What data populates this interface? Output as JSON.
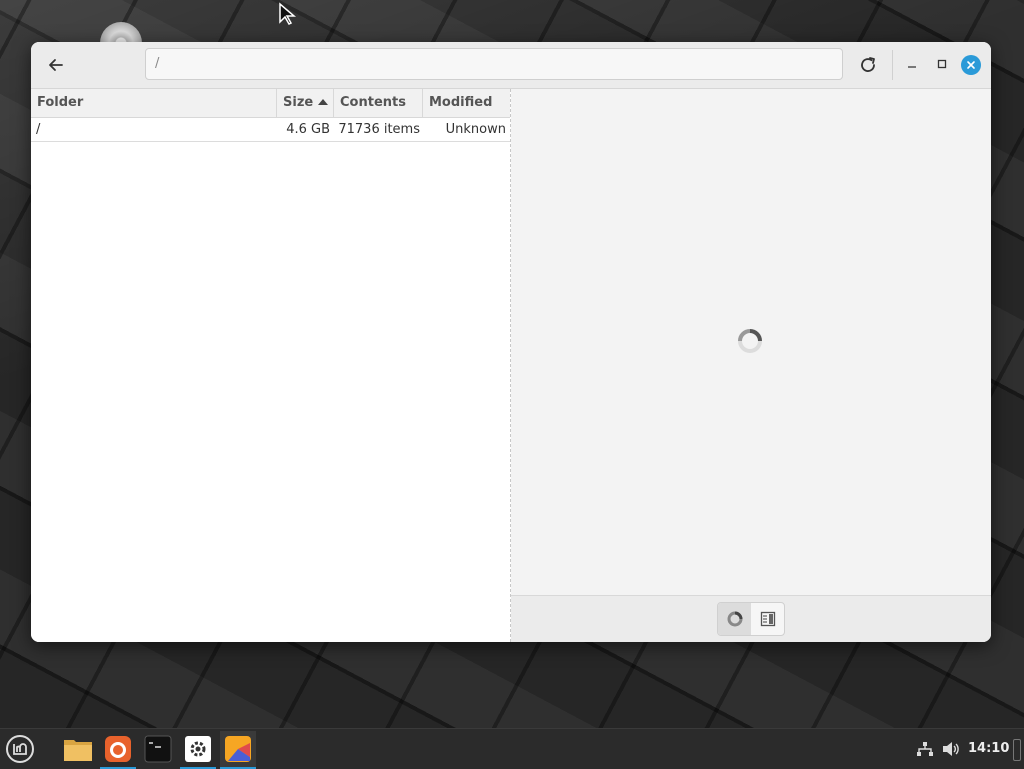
{
  "window": {
    "path_entry_value": "/"
  },
  "tree": {
    "columns": {
      "folder": "Folder",
      "size": "Size",
      "contents": "Contents",
      "modified": "Modified"
    },
    "sort": {
      "column": "size",
      "direction": "ascending"
    },
    "rows": [
      {
        "folder": "/",
        "size": "4.6 GB",
        "contents": "71736 items",
        "modified": "Unknown"
      }
    ]
  },
  "chart_view": {
    "state": "loading",
    "view_toggles": [
      {
        "icon": "rings-chart-icon",
        "active": true
      },
      {
        "icon": "treemap-chart-icon",
        "active": false
      }
    ]
  },
  "taskbar": {
    "apps": [
      "menu-icon",
      "files-icon",
      "firefox-icon",
      "terminal-icon",
      "settings-icon",
      "disk-usage-analyzer-icon"
    ],
    "clock": "14:10"
  },
  "colors": {
    "accent": "#2a9ad8",
    "window_bg": "#f4f4f4",
    "taskbar_bg": "#2b2b2b"
  }
}
